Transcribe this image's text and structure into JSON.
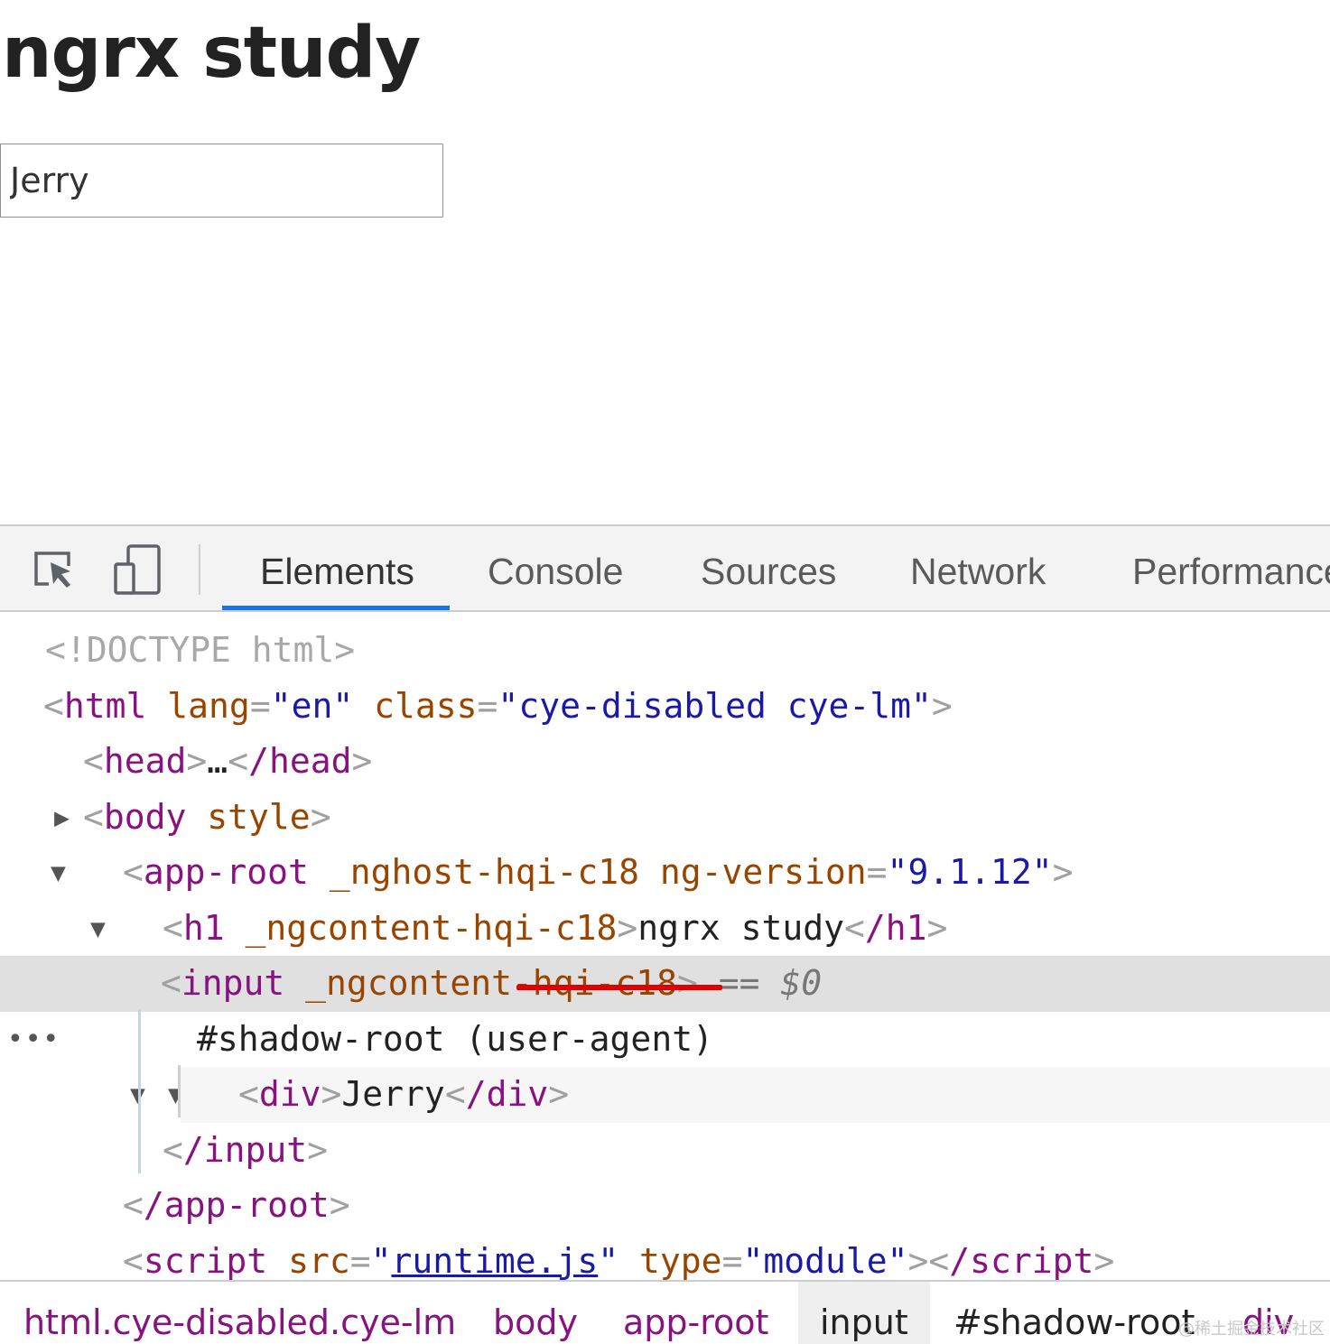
{
  "page": {
    "title": "ngrx study",
    "input_value": "Jerry"
  },
  "devtools": {
    "icons": [
      "inspect-element-icon",
      "device-toolbar-icon"
    ],
    "tabs": [
      {
        "label": "Elements",
        "active": true
      },
      {
        "label": "Console"
      },
      {
        "label": "Sources"
      },
      {
        "label": "Network"
      },
      {
        "label": "Performance"
      }
    ],
    "tree": {
      "doctype": "<!DOCTYPE html>",
      "html_open": {
        "tag": "html",
        "attr1": "lang",
        "val1": "en",
        "attr2": "class",
        "val2": "cye-disabled cye-lm"
      },
      "head": {
        "open": "head",
        "ellipsis": "…",
        "close": "/head"
      },
      "body": {
        "tag": "body",
        "attr": "style"
      },
      "app_root": {
        "tag": "app-root",
        "attr1": "_nghost-hqi-c18",
        "attr2": "ng-version",
        "val2": "9.1.12"
      },
      "h1": {
        "tag": "h1",
        "attr": "_ngcontent-hqi-c18",
        "text": "ngrx study",
        "close": "/h1"
      },
      "input": {
        "tag": "input",
        "attr": "_ngcontent-hqi-c18",
        "eq": "==",
        "ref": "$0"
      },
      "shadow_root": "#shadow-root (user-agent)",
      "div": {
        "tag": "div",
        "text": "Jerry",
        "close": "/div"
      },
      "input_close": "/input",
      "app_root_close": "/app-root",
      "script": {
        "tag": "script",
        "attr1": "src",
        "val1": "runtime.js",
        "attr2": "type",
        "val2": "module",
        "close": "/script"
      }
    },
    "breadcrumb": [
      "html.cye-disabled.cye-lm",
      "body",
      "app-root",
      "input",
      "#shadow-root",
      "div"
    ],
    "current_crumb": "input"
  },
  "watermark": "@稀土掘金技术社区",
  "colors": {
    "tag": "#881280",
    "attribute": "#994500",
    "value": "#1a1aa6",
    "active_tab_underline": "#1a73e8",
    "annotation_red": "#e00000"
  }
}
